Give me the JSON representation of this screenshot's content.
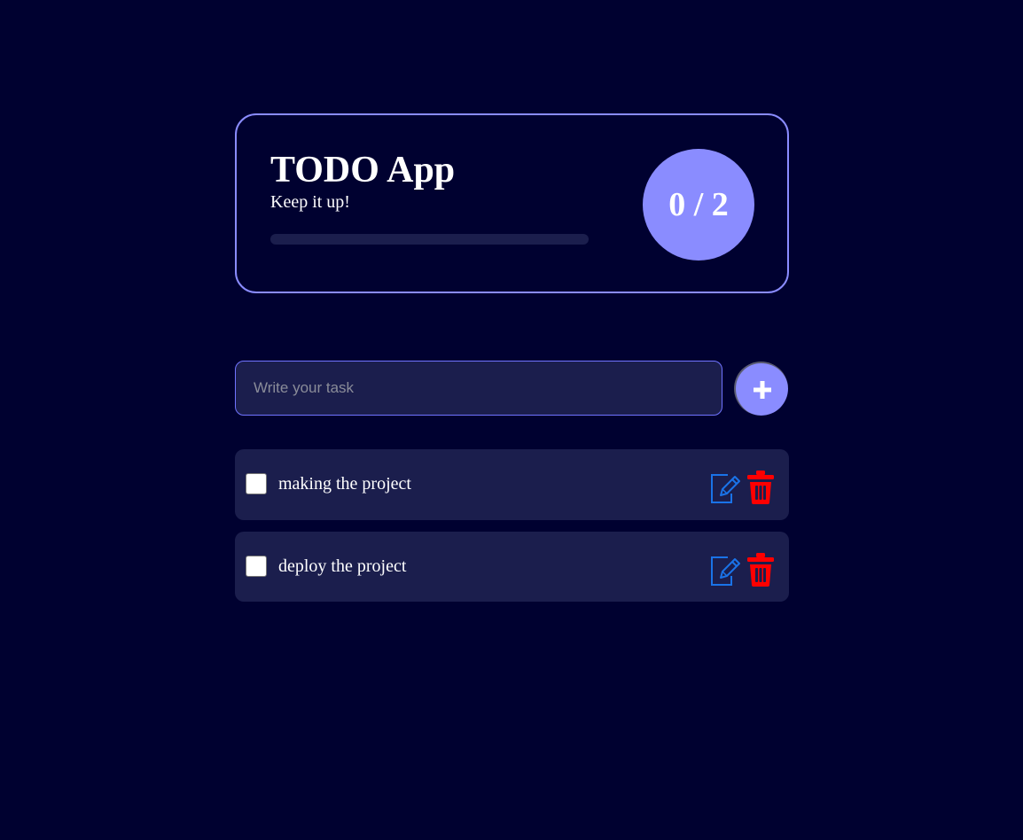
{
  "header": {
    "title": "TODO App",
    "subtitle": "Keep it up!",
    "progress_fraction": 0,
    "counter": "0 / 2"
  },
  "form": {
    "placeholder": "Write your task",
    "value": "",
    "add_icon": "plus-icon"
  },
  "tasks": [
    {
      "text": "making the project",
      "completed": false,
      "edit_icon": "edit-icon",
      "delete_icon": "trash-icon"
    },
    {
      "text": "deploy the project",
      "completed": false,
      "edit_icon": "edit-icon",
      "delete_icon": "trash-icon"
    }
  ],
  "colors": {
    "background": "#000130",
    "accent": "#8a8cff",
    "card": "#1b1e4d",
    "edit_icon": "#1a73e8",
    "delete_icon": "#ff0000"
  }
}
